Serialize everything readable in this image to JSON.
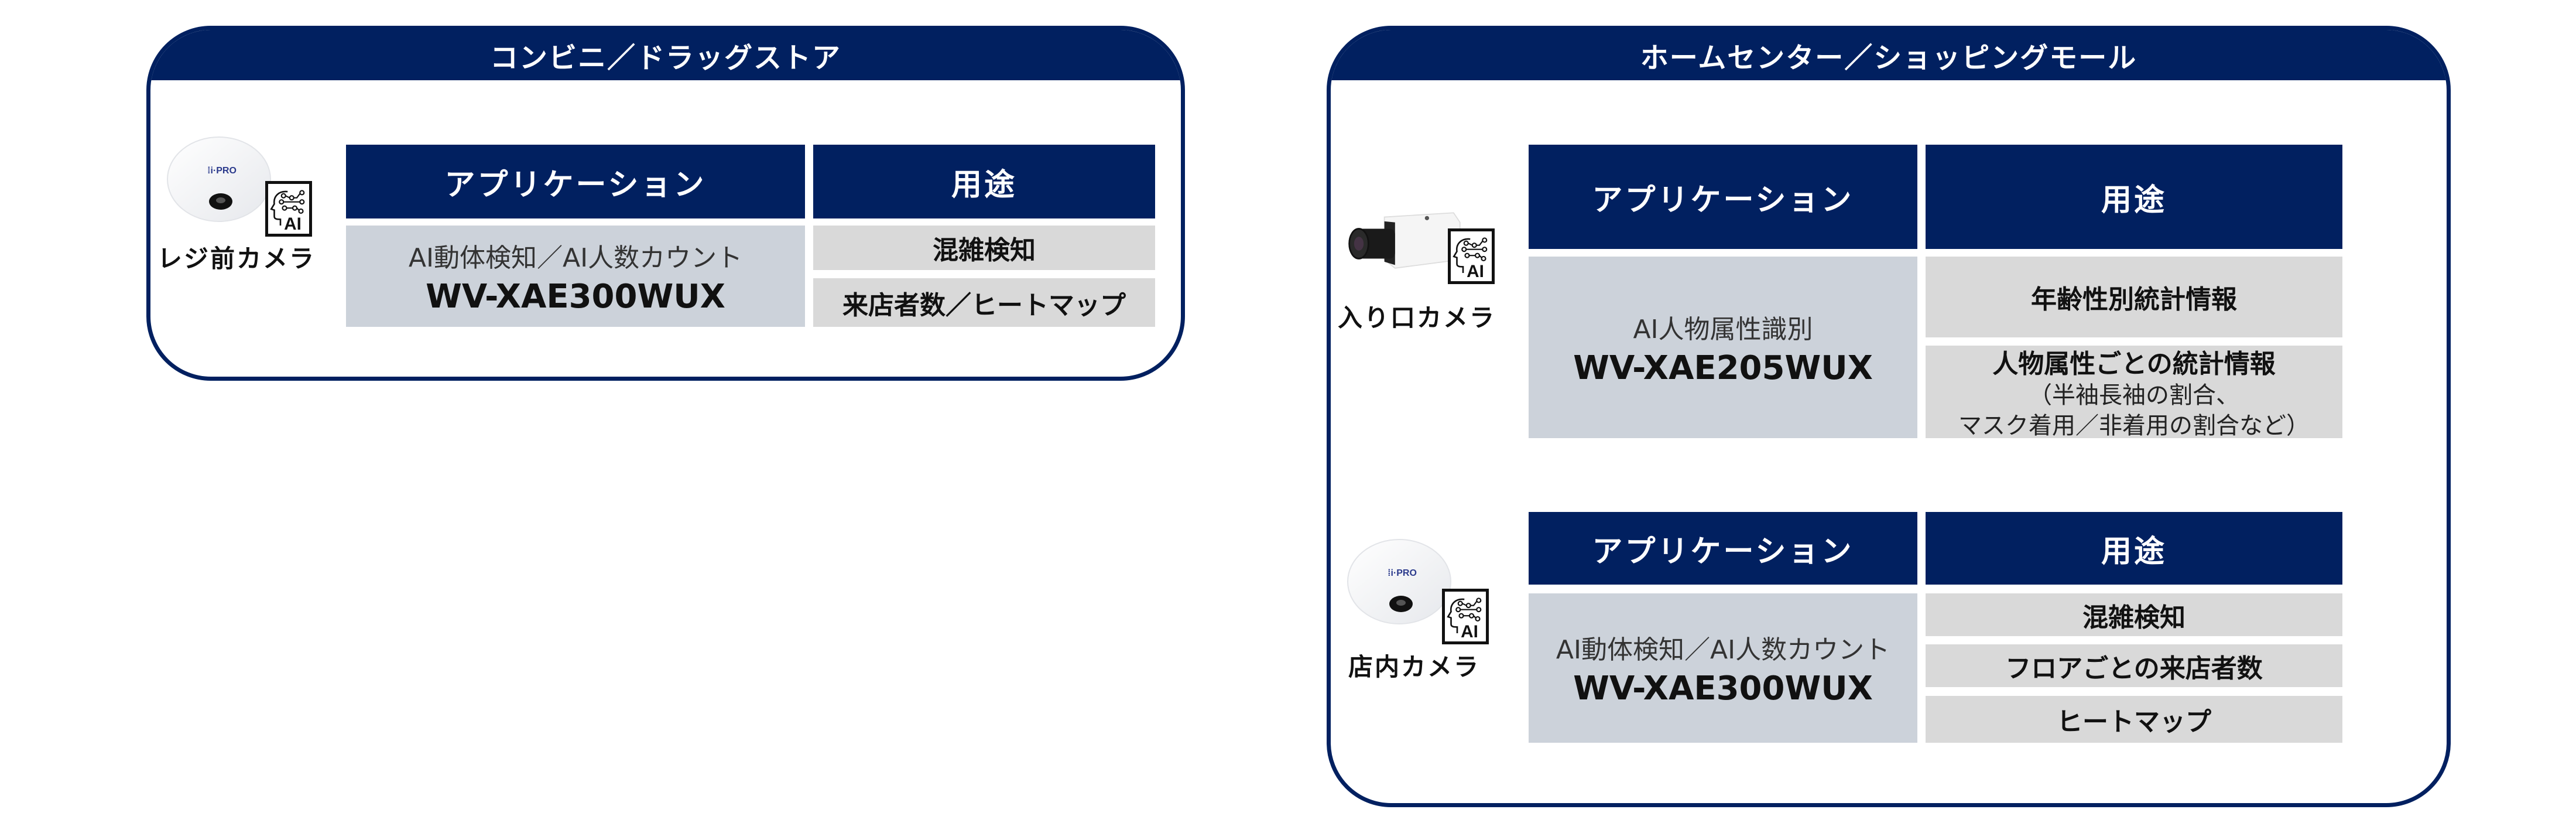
{
  "panels": [
    {
      "title": "コンビニ／ドラッグストア",
      "sections": [
        {
          "camera_label": "レジ前カメラ",
          "camera_type": "dome",
          "camera_brand": "i-PRO",
          "ai_badge": "AI",
          "header_app": "アプリケーション",
          "header_use": "用途",
          "application": "AI動体検知／AI人数カウント",
          "model": "WV-XAE300WUX",
          "uses": [
            {
              "label": "混雑検知"
            },
            {
              "label": "来店者数／ヒートマップ"
            }
          ]
        }
      ]
    },
    {
      "title": "ホームセンター／ショッピングモール",
      "sections": [
        {
          "camera_label": "入り口カメラ",
          "camera_type": "box",
          "ai_badge": "AI",
          "header_app": "アプリケーション",
          "header_use": "用途",
          "application": "AI人物属性識別",
          "model": "WV-XAE205WUX",
          "uses": [
            {
              "label": "年齢性別統計情報"
            },
            {
              "label": "人物属性ごとの統計情報",
              "note_line1": "（半袖長袖の割合、",
              "note_line2": "マスク着用／非着用の割合など）"
            }
          ]
        },
        {
          "camera_label": "店内カメラ",
          "camera_type": "dome",
          "camera_brand": "i-PRO",
          "ai_badge": "AI",
          "header_app": "アプリケーション",
          "header_use": "用途",
          "application": "AI動体検知／AI人数カウント",
          "model": "WV-XAE300WUX",
          "uses": [
            {
              "label": "混雑検知"
            },
            {
              "label": "フロアごとの来店者数"
            },
            {
              "label": "ヒートマップ"
            }
          ]
        }
      ]
    }
  ],
  "colors": {
    "navy": "#012060",
    "app_cell": "#ccd2da",
    "use_cell": "#d9d9d9"
  }
}
